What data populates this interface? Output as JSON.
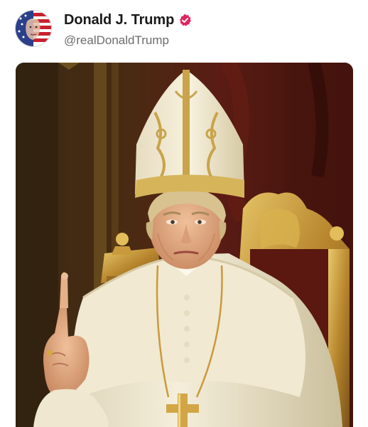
{
  "post": {
    "author": {
      "display_name": "Donald J. Trump",
      "handle": "@realDonaldTrump",
      "verified": true,
      "avatar_icon": "flag-portrait-avatar",
      "verified_icon": "verified-badge-icon"
    },
    "media": {
      "type": "image",
      "icon": "pope-portrait-image"
    }
  },
  "colors": {
    "verified_badge": "#e0245e",
    "name_text": "#1a1a1a",
    "handle_text": "#6b6b6b"
  }
}
